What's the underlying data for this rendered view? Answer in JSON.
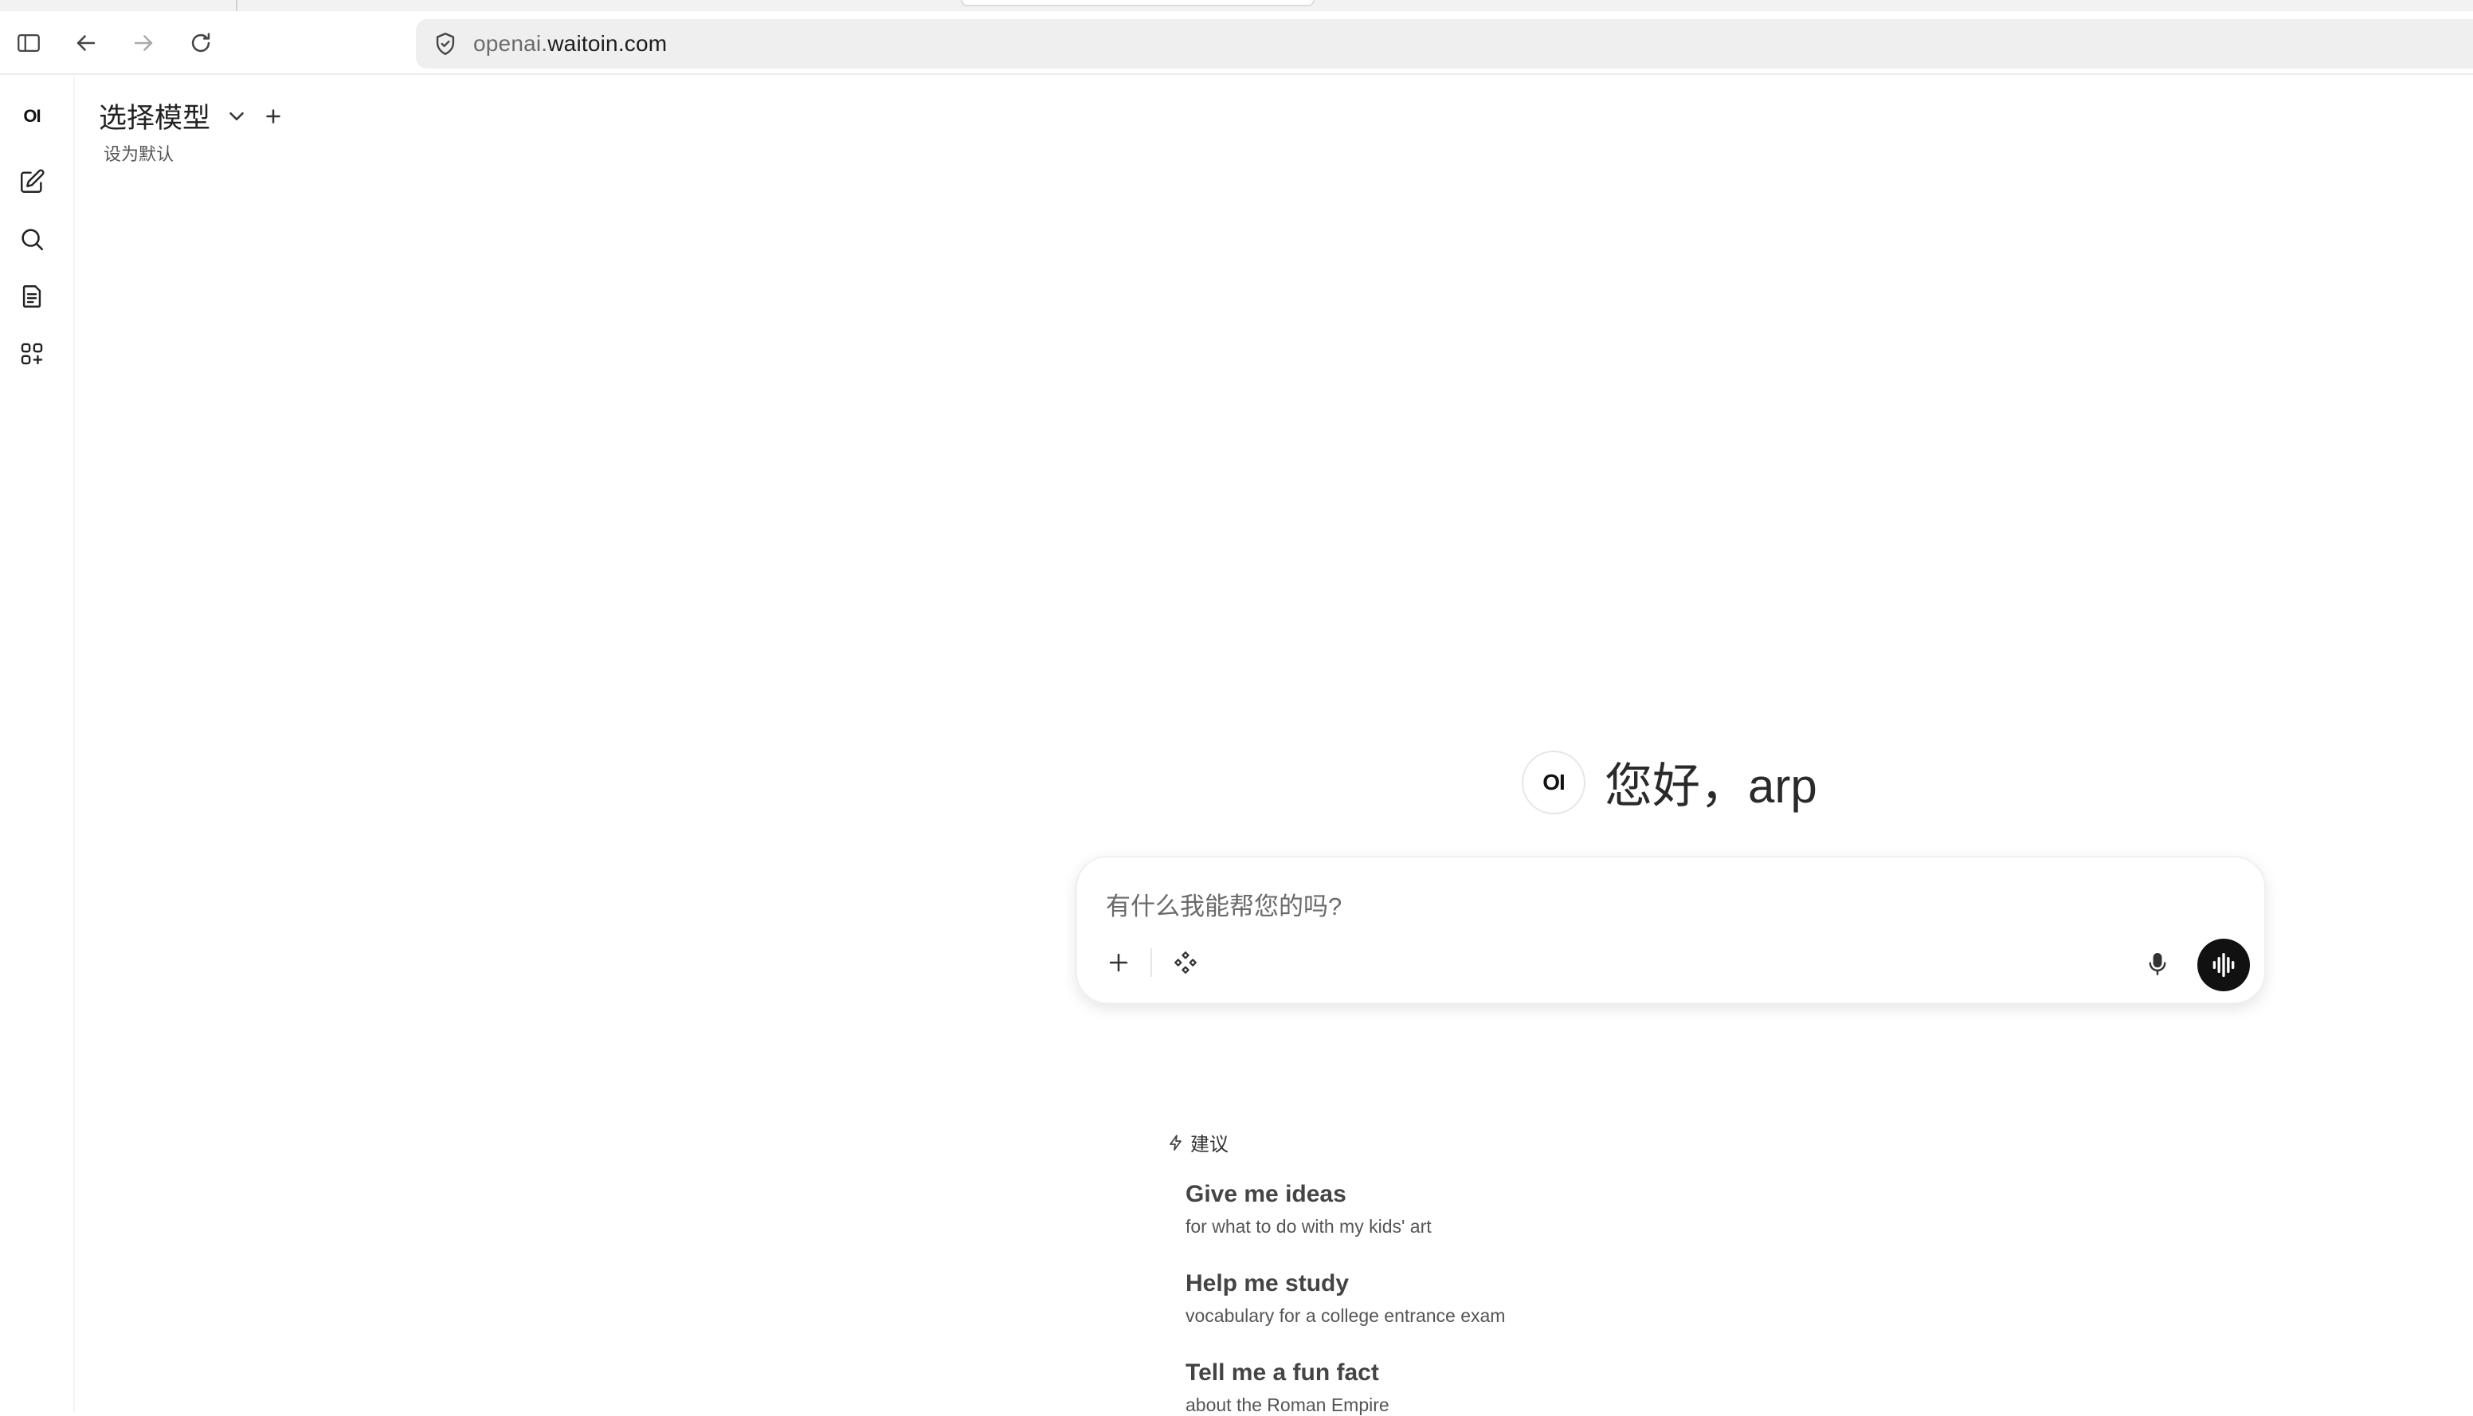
{
  "browser": {
    "url_subdomain": "openai.",
    "url_domain": "waitoin.com",
    "icons": {
      "sidebar_toggle": "sidebar-toggle-icon",
      "back": "arrow-left-icon",
      "forward": "arrow-right-icon",
      "reload": "reload-icon",
      "site_info": "shield-icon"
    }
  },
  "rail": {
    "logo": "OI",
    "items": [
      {
        "name": "new-chat",
        "icon": "pencil-square-icon"
      },
      {
        "name": "search",
        "icon": "search-icon"
      },
      {
        "name": "notes",
        "icon": "notes-icon"
      },
      {
        "name": "workspace",
        "icon": "grid-plus-icon"
      }
    ]
  },
  "header": {
    "model_label": "选择模型",
    "set_default": "设为默认"
  },
  "greeting": {
    "logo": "OI",
    "text": "您好，arp"
  },
  "chat": {
    "placeholder": "有什么我能帮您的吗?",
    "accent": "#111111"
  },
  "suggestions": {
    "header": "建议",
    "items": [
      {
        "title": "Give me ideas",
        "subtitle": "for what to do with my kids' art"
      },
      {
        "title": "Help me study",
        "subtitle": "vocabulary for a college entrance exam"
      },
      {
        "title": "Tell me a fun fact",
        "subtitle": "about the Roman Empire"
      }
    ]
  }
}
